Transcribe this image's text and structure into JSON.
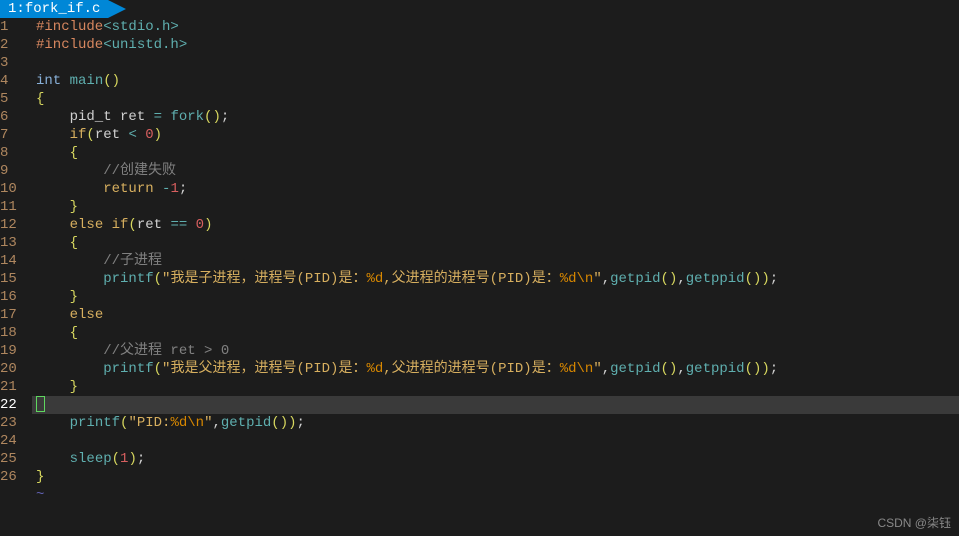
{
  "tab": {
    "index": "1",
    "filename": "fork_if.c"
  },
  "current_line": 22,
  "lines": [
    {
      "n": 1,
      "tokens": [
        {
          "cls": "preproc",
          "t": "#include"
        },
        {
          "cls": "header",
          "t": "<stdio.h>"
        }
      ]
    },
    {
      "n": 2,
      "tokens": [
        {
          "cls": "preproc",
          "t": "#include"
        },
        {
          "cls": "header",
          "t": "<unistd.h>"
        }
      ]
    },
    {
      "n": 3,
      "tokens": []
    },
    {
      "n": 4,
      "tokens": [
        {
          "cls": "kw-type",
          "t": "int"
        },
        {
          "cls": "",
          "t": " "
        },
        {
          "cls": "func",
          "t": "main"
        },
        {
          "cls": "paren",
          "t": "()"
        }
      ]
    },
    {
      "n": 5,
      "tokens": [
        {
          "cls": "brace",
          "t": "{"
        }
      ]
    },
    {
      "n": 6,
      "tokens": [
        {
          "cls": "",
          "t": "    pid_t ret "
        },
        {
          "cls": "op",
          "t": "= "
        },
        {
          "cls": "func",
          "t": "fork"
        },
        {
          "cls": "paren",
          "t": "()"
        },
        {
          "cls": "",
          "t": ";"
        }
      ]
    },
    {
      "n": 7,
      "tokens": [
        {
          "cls": "",
          "t": "    "
        },
        {
          "cls": "kw-ctrl",
          "t": "if"
        },
        {
          "cls": "paren",
          "t": "("
        },
        {
          "cls": "",
          "t": "ret "
        },
        {
          "cls": "op",
          "t": "<"
        },
        {
          "cls": "",
          "t": " "
        },
        {
          "cls": "number",
          "t": "0"
        },
        {
          "cls": "paren",
          "t": ")"
        }
      ]
    },
    {
      "n": 8,
      "tokens": [
        {
          "cls": "",
          "t": "    "
        },
        {
          "cls": "brace",
          "t": "{"
        }
      ]
    },
    {
      "n": 9,
      "tokens": [
        {
          "cls": "",
          "t": "        "
        },
        {
          "cls": "comment",
          "t": "//创建失败"
        }
      ]
    },
    {
      "n": 10,
      "tokens": [
        {
          "cls": "",
          "t": "        "
        },
        {
          "cls": "kw-ctrl",
          "t": "return"
        },
        {
          "cls": "",
          "t": " "
        },
        {
          "cls": "op",
          "t": "-"
        },
        {
          "cls": "number",
          "t": "1"
        },
        {
          "cls": "",
          "t": ";"
        }
      ]
    },
    {
      "n": 11,
      "tokens": [
        {
          "cls": "",
          "t": "    "
        },
        {
          "cls": "brace",
          "t": "}"
        }
      ]
    },
    {
      "n": 12,
      "tokens": [
        {
          "cls": "",
          "t": "    "
        },
        {
          "cls": "kw-ctrl",
          "t": "else if"
        },
        {
          "cls": "paren",
          "t": "("
        },
        {
          "cls": "",
          "t": "ret "
        },
        {
          "cls": "op",
          "t": "=="
        },
        {
          "cls": "",
          "t": " "
        },
        {
          "cls": "number",
          "t": "0"
        },
        {
          "cls": "paren",
          "t": ")"
        }
      ]
    },
    {
      "n": 13,
      "tokens": [
        {
          "cls": "",
          "t": "    "
        },
        {
          "cls": "brace",
          "t": "{"
        }
      ]
    },
    {
      "n": 14,
      "tokens": [
        {
          "cls": "",
          "t": "        "
        },
        {
          "cls": "comment",
          "t": "//子进程"
        }
      ]
    },
    {
      "n": 15,
      "tokens": [
        {
          "cls": "",
          "t": "        "
        },
        {
          "cls": "func",
          "t": "printf"
        },
        {
          "cls": "paren",
          "t": "("
        },
        {
          "cls": "string",
          "t": "\"我是子进程，进程号(PID)是："
        },
        {
          "cls": "format",
          "t": "%d"
        },
        {
          "cls": "string",
          "t": ",父进程的进程号(PID)是："
        },
        {
          "cls": "format",
          "t": "%d\\n"
        },
        {
          "cls": "string",
          "t": "\""
        },
        {
          "cls": "",
          "t": ","
        },
        {
          "cls": "func",
          "t": "getpid"
        },
        {
          "cls": "paren",
          "t": "()"
        },
        {
          "cls": "",
          "t": ","
        },
        {
          "cls": "func",
          "t": "getppid"
        },
        {
          "cls": "paren",
          "t": "())"
        },
        {
          "cls": "",
          "t": ";"
        }
      ]
    },
    {
      "n": 16,
      "tokens": [
        {
          "cls": "",
          "t": "    "
        },
        {
          "cls": "brace",
          "t": "}"
        }
      ]
    },
    {
      "n": 17,
      "tokens": [
        {
          "cls": "",
          "t": "    "
        },
        {
          "cls": "kw-ctrl",
          "t": "else"
        }
      ]
    },
    {
      "n": 18,
      "tokens": [
        {
          "cls": "",
          "t": "    "
        },
        {
          "cls": "brace",
          "t": "{"
        }
      ]
    },
    {
      "n": 19,
      "tokens": [
        {
          "cls": "",
          "t": "        "
        },
        {
          "cls": "comment",
          "t": "//父进程 ret > 0"
        }
      ]
    },
    {
      "n": 20,
      "tokens": [
        {
          "cls": "",
          "t": "        "
        },
        {
          "cls": "func",
          "t": "printf"
        },
        {
          "cls": "paren",
          "t": "("
        },
        {
          "cls": "string",
          "t": "\"我是父进程，进程号(PID)是："
        },
        {
          "cls": "format",
          "t": "%d"
        },
        {
          "cls": "string",
          "t": ",父进程的进程号(PID)是："
        },
        {
          "cls": "format",
          "t": "%d\\n"
        },
        {
          "cls": "string",
          "t": "\""
        },
        {
          "cls": "",
          "t": ","
        },
        {
          "cls": "func",
          "t": "getpid"
        },
        {
          "cls": "paren",
          "t": "()"
        },
        {
          "cls": "",
          "t": ","
        },
        {
          "cls": "func",
          "t": "getppid"
        },
        {
          "cls": "paren",
          "t": "())"
        },
        {
          "cls": "",
          "t": ";"
        }
      ]
    },
    {
      "n": 21,
      "tokens": [
        {
          "cls": "",
          "t": "    "
        },
        {
          "cls": "brace",
          "t": "}"
        }
      ]
    },
    {
      "n": 22,
      "tokens": [],
      "cursor": true
    },
    {
      "n": 23,
      "tokens": [
        {
          "cls": "",
          "t": "    "
        },
        {
          "cls": "func",
          "t": "printf"
        },
        {
          "cls": "paren",
          "t": "("
        },
        {
          "cls": "string",
          "t": "\"PID:"
        },
        {
          "cls": "format",
          "t": "%d\\n"
        },
        {
          "cls": "string",
          "t": "\""
        },
        {
          "cls": "",
          "t": ","
        },
        {
          "cls": "func",
          "t": "getpid"
        },
        {
          "cls": "paren",
          "t": "())"
        },
        {
          "cls": "",
          "t": ";"
        }
      ]
    },
    {
      "n": 24,
      "tokens": []
    },
    {
      "n": 25,
      "tokens": [
        {
          "cls": "",
          "t": "    "
        },
        {
          "cls": "func",
          "t": "sleep"
        },
        {
          "cls": "paren",
          "t": "("
        },
        {
          "cls": "number",
          "t": "1"
        },
        {
          "cls": "paren",
          "t": ")"
        },
        {
          "cls": "",
          "t": ";"
        }
      ]
    },
    {
      "n": 26,
      "tokens": [
        {
          "cls": "brace",
          "t": "}"
        }
      ]
    }
  ],
  "watermark": "CSDN @柒钰"
}
